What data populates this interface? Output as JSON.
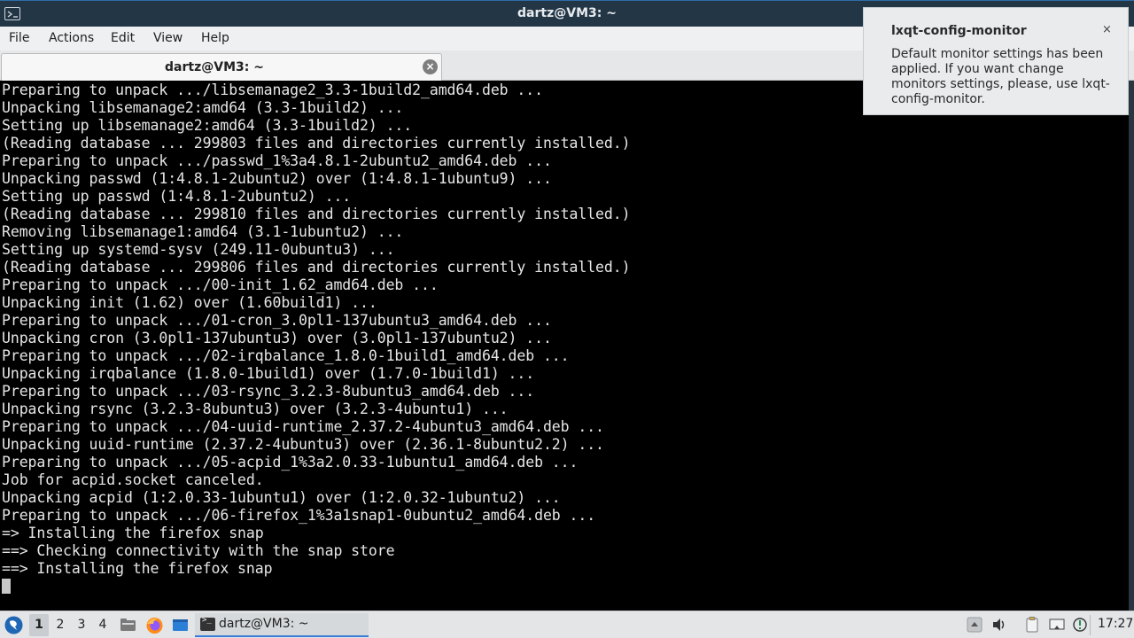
{
  "window": {
    "title": "dartz@VM3: ~"
  },
  "menu": {
    "items": [
      "File",
      "Actions",
      "Edit",
      "View",
      "Help"
    ]
  },
  "tab": {
    "label": "dartz@VM3: ~"
  },
  "terminal": {
    "lines": [
      "Preparing to unpack .../libsemanage2_3.3-1build2_amd64.deb ...",
      "Unpacking libsemanage2:amd64 (3.3-1build2) ...",
      "Setting up libsemanage2:amd64 (3.3-1build2) ...",
      "(Reading database ... 299803 files and directories currently installed.)",
      "Preparing to unpack .../passwd_1%3a4.8.1-2ubuntu2_amd64.deb ...",
      "Unpacking passwd (1:4.8.1-2ubuntu2) over (1:4.8.1-1ubuntu9) ...",
      "Setting up passwd (1:4.8.1-2ubuntu2) ...",
      "(Reading database ... 299810 files and directories currently installed.)",
      "Removing libsemanage1:amd64 (3.1-1ubuntu2) ...",
      "Setting up systemd-sysv (249.11-0ubuntu3) ...",
      "(Reading database ... 299806 files and directories currently installed.)",
      "Preparing to unpack .../00-init_1.62_amd64.deb ...",
      "Unpacking init (1.62) over (1.60build1) ...",
      "Preparing to unpack .../01-cron_3.0pl1-137ubuntu3_amd64.deb ...",
      "Unpacking cron (3.0pl1-137ubuntu3) over (3.0pl1-137ubuntu2) ...",
      "Preparing to unpack .../02-irqbalance_1.8.0-1build1_amd64.deb ...",
      "Unpacking irqbalance (1.8.0-1build1) over (1.7.0-1build1) ...",
      "Preparing to unpack .../03-rsync_3.2.3-8ubuntu3_amd64.deb ...",
      "Unpacking rsync (3.2.3-8ubuntu3) over (3.2.3-4ubuntu1) ...",
      "Preparing to unpack .../04-uuid-runtime_2.37.2-4ubuntu3_amd64.deb ...",
      "Unpacking uuid-runtime (2.37.2-4ubuntu3) over (2.36.1-8ubuntu2.2) ...",
      "Preparing to unpack .../05-acpid_1%3a2.0.33-1ubuntu1_amd64.deb ...",
      "Job for acpid.socket canceled.",
      "Unpacking acpid (1:2.0.33-1ubuntu1) over (1:2.0.32-1ubuntu2) ...",
      "Preparing to unpack .../06-firefox_1%3a1snap1-0ubuntu2_amd64.deb ...",
      "=> Installing the firefox snap",
      "==> Checking connectivity with the snap store",
      "==> Installing the firefox snap"
    ]
  },
  "notification": {
    "title": "lxqt-config-monitor",
    "close": "×",
    "body": "Default monitor settings has been applied. If you want change monitors settings, please, use lxqt-config-monitor."
  },
  "taskbar": {
    "workspaces": [
      "1",
      "2",
      "3",
      "4"
    ],
    "active_workspace": "1",
    "task_label": "dartz@VM3: ~",
    "clock": "17:27",
    "icons": [
      "start-menu-icon",
      "file-manager-icon",
      "firefox-icon",
      "show-desktop-icon",
      "terminal-icon"
    ],
    "tray_icons": [
      "tray-arrow-icon",
      "volume-icon",
      "clipboard-icon",
      "network-icon",
      "update-notifier-icon"
    ]
  },
  "colors": {
    "titlebar": "#233646",
    "terminal_bg": "#000000",
    "terminal_fg": "#e6e6e6",
    "taskbar": "#e3e5e7",
    "accent": "#3a7bd5"
  }
}
